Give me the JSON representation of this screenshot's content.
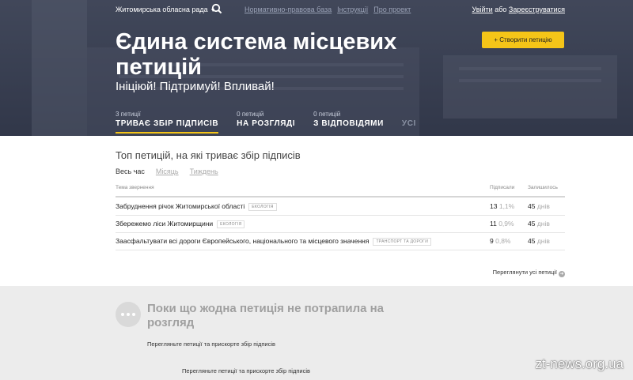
{
  "header": {
    "council": "Житомирська обласна рада",
    "nav": [
      "Нормативно-правова база",
      "Інструкції",
      "Про проект"
    ],
    "login": "Увійти",
    "or": "або",
    "register": "Зареєструватися",
    "title": "Єдина система місцевих петицій",
    "slogan": "Ініціюй! Підтримуй! Впливай!",
    "create_button": "+ Створити петицію",
    "tabs": [
      {
        "count": "3 петиції",
        "label": "ТРИВАЄ ЗБІР ПІДПИСІВ"
      },
      {
        "count": "0 петицій",
        "label": "НА РОЗГЛЯДІ"
      },
      {
        "count": "0 петицій",
        "label": "З ВІДПОВІДЯМИ"
      },
      {
        "count": "",
        "label": "УСІ"
      }
    ]
  },
  "main": {
    "section_title": "Топ петицій, на які триває збір підписів",
    "periods": [
      "Весь час",
      "Місяць",
      "Тиждень"
    ],
    "columns": {
      "topic": "Тема звернення",
      "signed": "Підписали",
      "left": "Залишилось"
    },
    "rows": [
      {
        "name": "Забруднення річок Житомирської області",
        "tag": "Екологія",
        "signed": "13",
        "pct": "1,1%",
        "days": "45",
        "unit": "днів"
      },
      {
        "name": "Збережемо ліси Житомирщини",
        "tag": "Екологія",
        "signed": "11",
        "pct": "0,9%",
        "days": "45",
        "unit": "днів"
      },
      {
        "name": "Заасфальтувати всі дороги Європейського, національного та місцевого значення",
        "tag": "Транспорт та дороги",
        "signed": "9",
        "pct": "0,8%",
        "days": "45",
        "unit": "днів"
      }
    ],
    "view_all": "Переглянути усі петиції"
  },
  "empty": {
    "title": "Поки що жодна петиція не потрапила на розгляд",
    "subtitle": "Перегляньте петиції та прискорте збір підписів",
    "subtitle2": "Перегляньте петиції та прискорте збір підписів"
  },
  "watermark": "zt-news.org.ua",
  "colors": {
    "accent": "#f5c518",
    "hero": "#4d5568",
    "gray_bg": "#ececec"
  }
}
